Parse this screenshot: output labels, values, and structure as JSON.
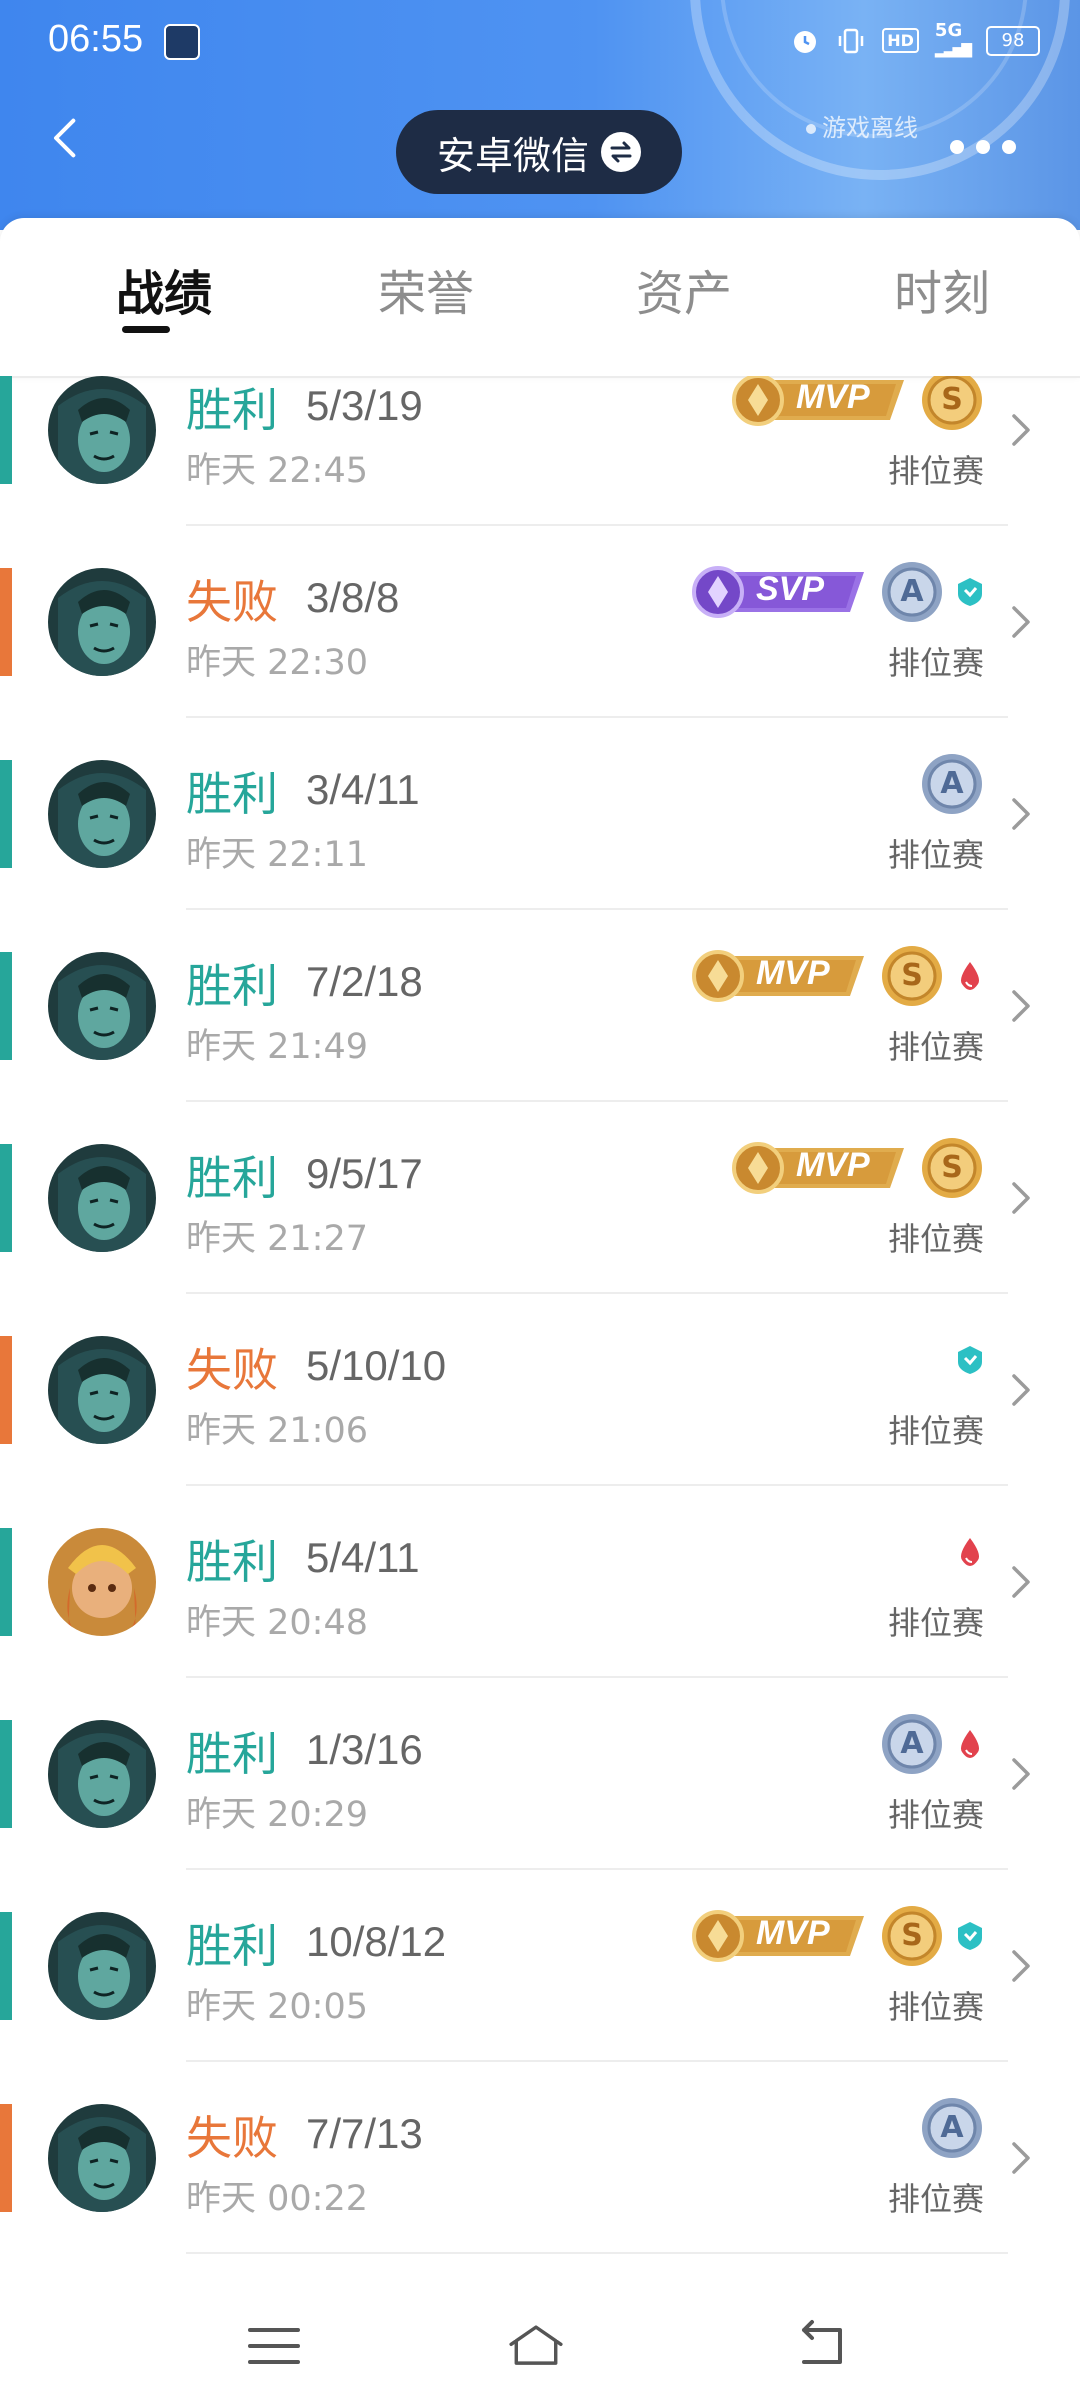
{
  "status_bar": {
    "time": "06:55",
    "icons": [
      "alarm-icon",
      "vibrate-icon",
      "hd-icon",
      "5g-signal-icon",
      "battery-icon"
    ],
    "hd_label": "HD",
    "network_label": "5G",
    "battery": "98"
  },
  "header": {
    "account_label": "安卓微信",
    "status_text": "游戏离线"
  },
  "tabs": [
    {
      "label": "战绩",
      "active": true
    },
    {
      "label": "荣誉",
      "active": false
    },
    {
      "label": "资产",
      "active": false
    },
    {
      "label": "时刻",
      "active": false
    }
  ],
  "colors": {
    "win": "#26a69a",
    "loss": "#e8773a",
    "header": "#4a8ff0"
  },
  "matches": [
    {
      "result": "胜利",
      "outcome": "win",
      "kda": "5/3/19",
      "time": "昨天 22:45",
      "mode": "排位赛",
      "avatar": "hero-dark",
      "badges": [
        "mvp",
        "grade-S"
      ],
      "badge_labels": {
        "mvp": "MVP",
        "grade": "S"
      }
    },
    {
      "result": "失败",
      "outcome": "loss",
      "kda": "3/8/8",
      "time": "昨天 22:30",
      "mode": "排位赛",
      "avatar": "hero-dark",
      "badges": [
        "svp",
        "grade-A",
        "shield"
      ],
      "badge_labels": {
        "svp": "SVP",
        "grade": "A"
      }
    },
    {
      "result": "胜利",
      "outcome": "win",
      "kda": "3/4/11",
      "time": "昨天 22:11",
      "mode": "排位赛",
      "avatar": "hero-dark",
      "badges": [
        "grade-A"
      ],
      "badge_labels": {
        "grade": "A"
      }
    },
    {
      "result": "胜利",
      "outcome": "win",
      "kda": "7/2/18",
      "time": "昨天 21:49",
      "mode": "排位赛",
      "avatar": "hero-dark",
      "badges": [
        "mvp",
        "grade-S",
        "blood"
      ],
      "badge_labels": {
        "mvp": "MVP",
        "grade": "S"
      }
    },
    {
      "result": "胜利",
      "outcome": "win",
      "kda": "9/5/17",
      "time": "昨天 21:27",
      "mode": "排位赛",
      "avatar": "hero-dark",
      "badges": [
        "mvp",
        "grade-S"
      ],
      "badge_labels": {
        "mvp": "MVP",
        "grade": "S"
      }
    },
    {
      "result": "失败",
      "outcome": "loss",
      "kda": "5/10/10",
      "time": "昨天 21:06",
      "mode": "排位赛",
      "avatar": "hero-dark",
      "badges": [
        "shield"
      ],
      "badge_labels": {}
    },
    {
      "result": "胜利",
      "outcome": "win",
      "kda": "5/4/11",
      "time": "昨天 20:48",
      "mode": "排位赛",
      "avatar": "hero-gold",
      "badges": [
        "blood"
      ],
      "badge_labels": {}
    },
    {
      "result": "胜利",
      "outcome": "win",
      "kda": "1/3/16",
      "time": "昨天 20:29",
      "mode": "排位赛",
      "avatar": "hero-dark",
      "badges": [
        "grade-A",
        "blood"
      ],
      "badge_labels": {
        "grade": "A"
      }
    },
    {
      "result": "胜利",
      "outcome": "win",
      "kda": "10/8/12",
      "time": "昨天 20:05",
      "mode": "排位赛",
      "avatar": "hero-dark",
      "badges": [
        "mvp",
        "grade-S",
        "shield"
      ],
      "badge_labels": {
        "mvp": "MVP",
        "grade": "S"
      }
    },
    {
      "result": "失败",
      "outcome": "loss",
      "kda": "7/7/13",
      "time": "昨天 00:22",
      "mode": "排位赛",
      "avatar": "hero-dark",
      "badges": [
        "grade-A"
      ],
      "badge_labels": {
        "grade": "A"
      }
    }
  ],
  "navbar": [
    "menu-icon",
    "home-icon",
    "back-icon"
  ]
}
